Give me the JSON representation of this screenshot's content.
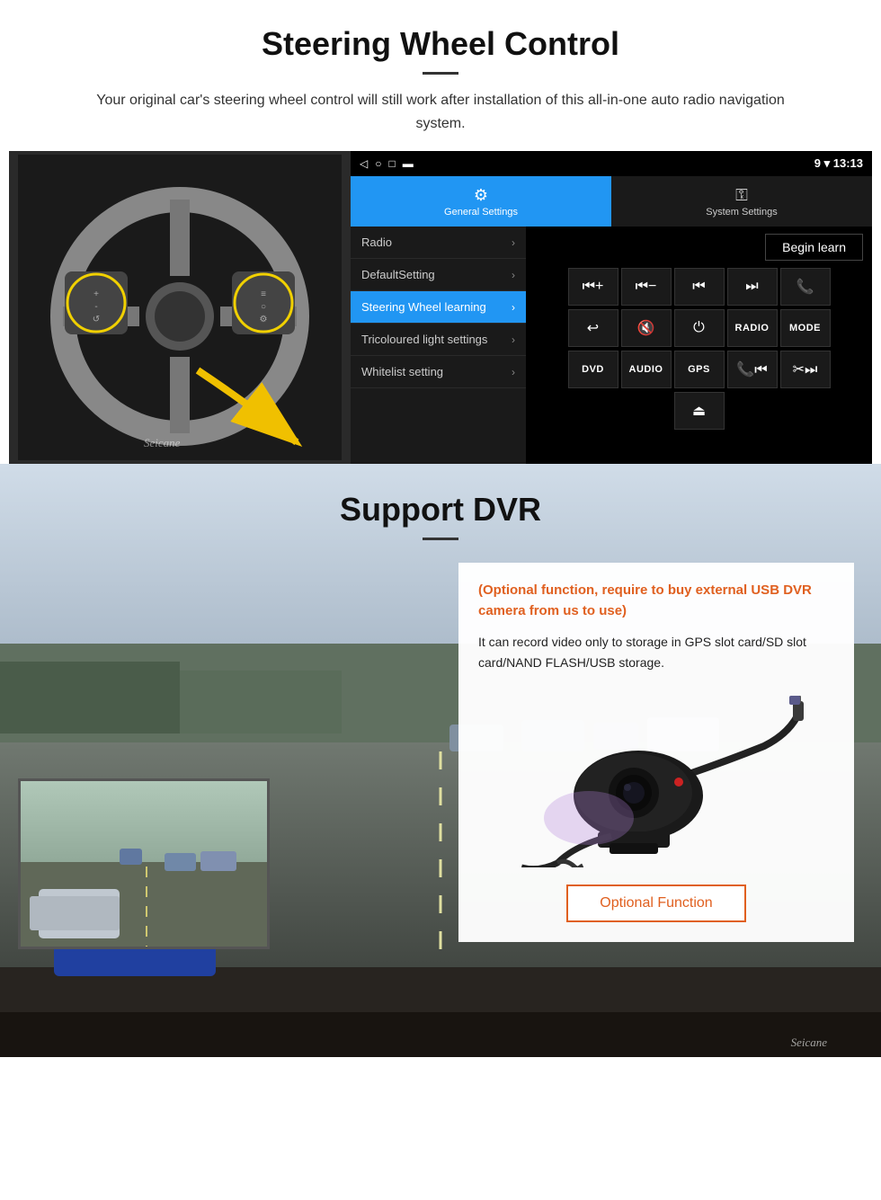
{
  "header": {
    "title": "Steering Wheel Control",
    "subtitle": "Your original car's steering wheel control will still work after installation of this all-in-one auto radio navigation system."
  },
  "android_ui": {
    "statusbar": {
      "time": "13:13",
      "signal_icon": "▼",
      "wifi_icon": "▾"
    },
    "tabs": {
      "general": {
        "label": "General Settings",
        "icon": "⚙"
      },
      "system": {
        "label": "System Settings",
        "icon": "⚿"
      }
    },
    "menu_items": [
      {
        "label": "Radio",
        "active": false
      },
      {
        "label": "DefaultSetting",
        "active": false
      },
      {
        "label": "Steering Wheel learning",
        "active": true
      },
      {
        "label": "Tricoloured light settings",
        "active": false
      },
      {
        "label": "Whitelist setting",
        "active": false
      }
    ],
    "begin_learn_label": "Begin learn",
    "control_buttons": [
      [
        "⏮+",
        "⏮-",
        "⏮⏮",
        "⏭⏭",
        "📞"
      ],
      [
        "↩",
        "🔇",
        "⏻",
        "RADIO",
        "MODE"
      ],
      [
        "DVD",
        "AUDIO",
        "GPS",
        "📞⏮",
        "✂⏭"
      ],
      [
        "⏏"
      ]
    ]
  },
  "dvr_section": {
    "title": "Support DVR",
    "optional_text": "(Optional function, require to buy external USB DVR camera from us to use)",
    "description": "It can record video only to storage in GPS slot card/SD slot card/NAND FLASH/USB storage.",
    "optional_function_label": "Optional Function",
    "watermark": "Seicane"
  }
}
